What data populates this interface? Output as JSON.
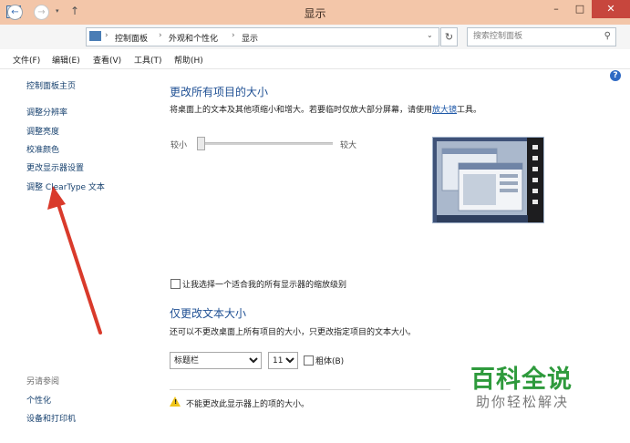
{
  "window": {
    "title": "显示",
    "min": "–",
    "max": "□",
    "close": "✕"
  },
  "nav": {
    "back": "←",
    "forward": "→",
    "history": "▾",
    "up": "↑",
    "breadcrumb": [
      "控制面板",
      "外观和个性化",
      "显示"
    ],
    "separator": "›",
    "address_dropdown": "⌄",
    "refresh": "↻",
    "search_placeholder": "搜索控制面板",
    "search_glyph": "⚲"
  },
  "menu": [
    "文件(F)",
    "编辑(E)",
    "查看(V)",
    "工具(T)",
    "帮助(H)"
  ],
  "sidebar": {
    "home": "控制面板主页",
    "links": [
      "调整分辨率",
      "调整亮度",
      "校准颜色",
      "更改显示器设置",
      "调整 ClearType 文本"
    ],
    "see_also_label": "另请参阅",
    "see_also": [
      "个性化",
      "设备和打印机"
    ]
  },
  "main": {
    "heading1": "更改所有项目的大小",
    "desc1_pre": "将桌面上的文本及其他项缩小和增大。若要临时仅放大部分屏幕，请使用",
    "desc1_link": "放大镜",
    "desc1_post": "工具。",
    "slider_small": "较小",
    "slider_large": "较大",
    "slider_level": 0,
    "checkbox_label": "让我选择一个适合我的所有显示器的缩放级别",
    "heading2": "仅更改文本大小",
    "desc2": "还可以不更改桌面上所有项目的大小，只更改指定项目的文本大小。",
    "item_select": "标题栏",
    "size_select": "11",
    "bold_label": "粗体(B)",
    "warning": "不能更改此显示器上的项的大小。"
  },
  "help_glyph": "?",
  "watermark": {
    "main": "百科全说",
    "sub": "助你轻松解决"
  },
  "colors": {
    "titlebar": "#f3c6a9",
    "close": "#c7463d",
    "heading": "#1e4f93",
    "annotation_arrow": "#d93a2b",
    "watermark": "#2e9a3c"
  }
}
